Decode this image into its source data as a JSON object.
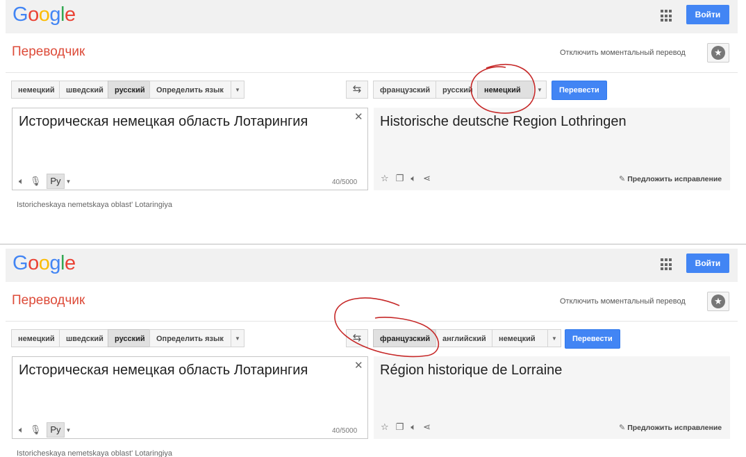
{
  "panels": [
    {
      "logo_letters": [
        {
          "ch": "G",
          "color": "#4285f4"
        },
        {
          "ch": "o",
          "color": "#ea4335"
        },
        {
          "ch": "o",
          "color": "#fbbc05"
        },
        {
          "ch": "g",
          "color": "#4285f4"
        },
        {
          "ch": "l",
          "color": "#34a853"
        },
        {
          "ch": "e",
          "color": "#ea4335"
        }
      ],
      "signin_label": "Войти",
      "title": "Переводчик",
      "instant_label": "Отключить моментальный перевод",
      "source_langs": [
        {
          "label": "немецкий",
          "selected": false
        },
        {
          "label": "шведский",
          "selected": false
        },
        {
          "label": "русский",
          "selected": true
        },
        {
          "label": "Определить язык",
          "selected": false
        }
      ],
      "target_langs": [
        {
          "label": "французский",
          "selected": false
        },
        {
          "label": "русский",
          "selected": false
        },
        {
          "label": "немецкий",
          "selected": true
        }
      ],
      "translate_label": "Перевести",
      "source_text": "Историческая немецкая область Лотарингия",
      "input_lang_badge": "Ру",
      "char_count": "40/5000",
      "result_text": "Historische deutsche Region Lothringen",
      "suggest_label": "Предложить исправление",
      "transliteration": "Istoricheskaya nemetskaya oblast' Lotaringiya"
    },
    {
      "logo_letters": [
        {
          "ch": "G",
          "color": "#4285f4"
        },
        {
          "ch": "o",
          "color": "#ea4335"
        },
        {
          "ch": "o",
          "color": "#fbbc05"
        },
        {
          "ch": "g",
          "color": "#4285f4"
        },
        {
          "ch": "l",
          "color": "#34a853"
        },
        {
          "ch": "e",
          "color": "#ea4335"
        }
      ],
      "signin_label": "Войти",
      "title": "Переводчик",
      "instant_label": "Отключить моментальный перевод",
      "source_langs": [
        {
          "label": "немецкий",
          "selected": false
        },
        {
          "label": "шведский",
          "selected": false
        },
        {
          "label": "русский",
          "selected": true
        },
        {
          "label": "Определить язык",
          "selected": false
        }
      ],
      "target_langs": [
        {
          "label": "французский",
          "selected": true
        },
        {
          "label": "английский",
          "selected": false
        },
        {
          "label": "немецкий",
          "selected": false
        }
      ],
      "translate_label": "Перевести",
      "source_text": "Историческая немецкая область Лотарингия",
      "input_lang_badge": "Ру",
      "char_count": "40/5000",
      "result_text": "Région historique de Lorraine",
      "suggest_label": "Предложить исправление",
      "transliteration": "Istoricheskaya nemetskaya oblast' Lotaringiya"
    }
  ],
  "colors": {
    "accent_blue": "#4285f4",
    "title_red": "#dd4b39",
    "annotation_red": "#c62828"
  },
  "icons": [
    "apps-grid-icon",
    "star-icon",
    "swap-icon",
    "close-icon",
    "speaker-icon",
    "mic-icon",
    "copy-icon",
    "share-icon",
    "pencil-icon"
  ]
}
